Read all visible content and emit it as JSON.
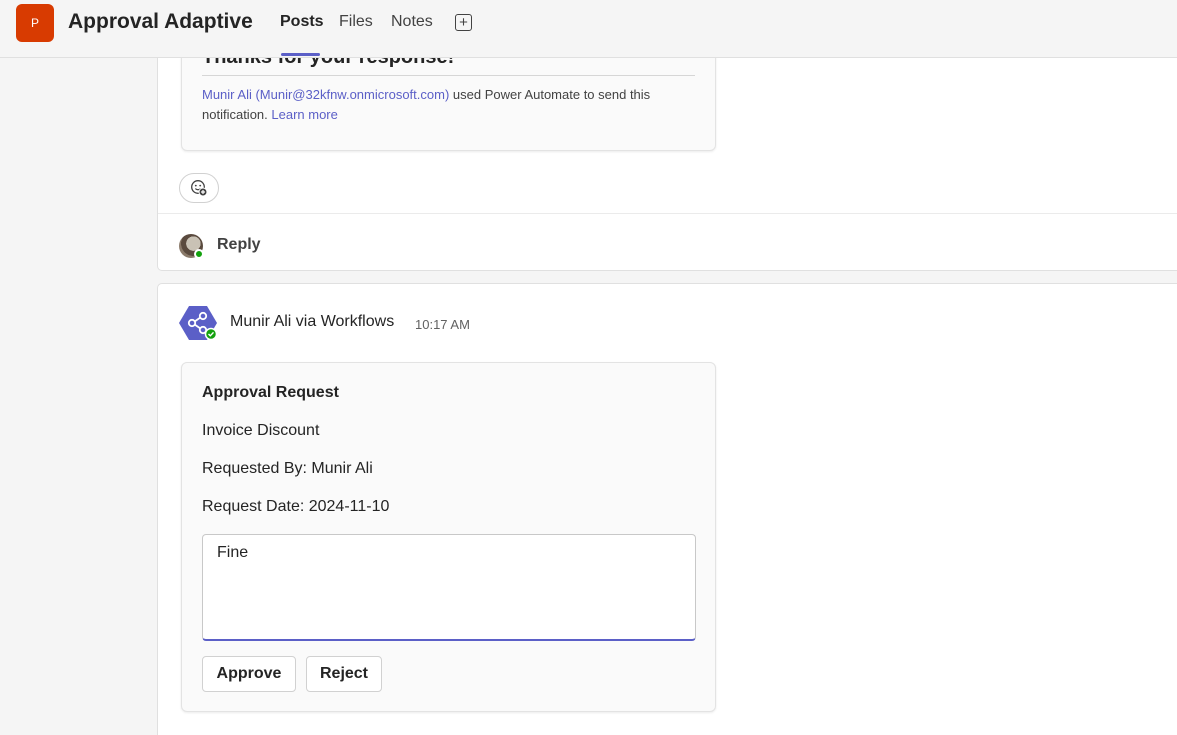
{
  "header": {
    "team_initial": "P",
    "team_name": "Approval Adaptive",
    "tabs": [
      {
        "label": "Posts",
        "active": true
      },
      {
        "label": "Files",
        "active": false
      },
      {
        "label": "Notes",
        "active": false
      }
    ],
    "add_tab_icon": "plus-square-icon"
  },
  "thread1": {
    "card_title": "Thanks for your response!",
    "note_author": "Munir Ali (Munir@32kfnw.onmicrosoft.com)",
    "note_text": " used Power Automate to send this notification. ",
    "note_link": "Learn more",
    "reaction_icon": "add-reaction-icon",
    "reply_label": "Reply"
  },
  "thread2": {
    "sender": "Munir Ali via Workflows",
    "timestamp": "10:17 AM",
    "card": {
      "title": "Approval Request",
      "subject": "Invoice Discount",
      "requested_by": "Requested By: Munir Ali",
      "request_date": "Request Date: 2024-11-10",
      "comment_value": "Fine",
      "approve_label": "Approve",
      "reject_label": "Reject"
    }
  },
  "colors": {
    "brand": "#5b5fc7",
    "team_icon": "#d83b01",
    "presence_online": "#13a10e",
    "workflow_avatar": "#5b5fc7"
  }
}
